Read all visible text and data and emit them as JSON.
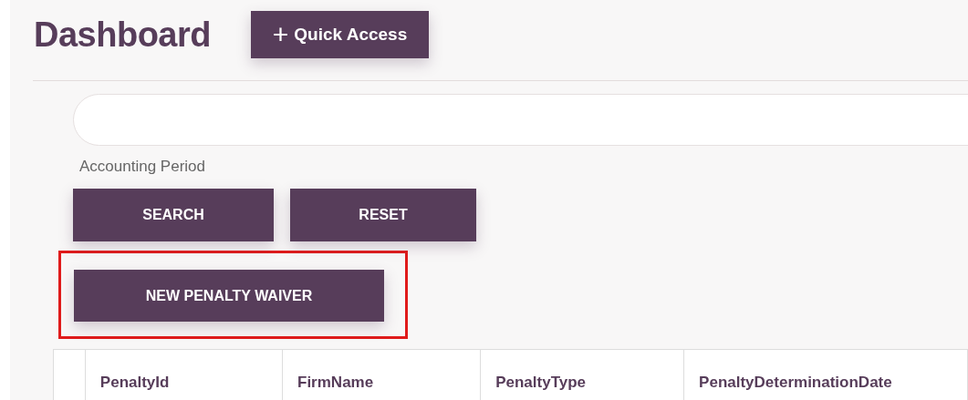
{
  "header": {
    "title": "Dashboard",
    "quick_access": {
      "icon": "+",
      "label": "Quick Access"
    }
  },
  "filter": {
    "label": "Accounting Period"
  },
  "actions": [
    {
      "label": "SEARCH"
    },
    {
      "label": "RESET"
    }
  ],
  "new_button": {
    "label": "NEW PENALTY WAIVER",
    "highlighted": true
  },
  "table": {
    "columns": [
      "",
      "PenaltyId",
      "FirmName",
      "PenaltyType",
      "PenaltyDeterminationDate"
    ]
  }
}
